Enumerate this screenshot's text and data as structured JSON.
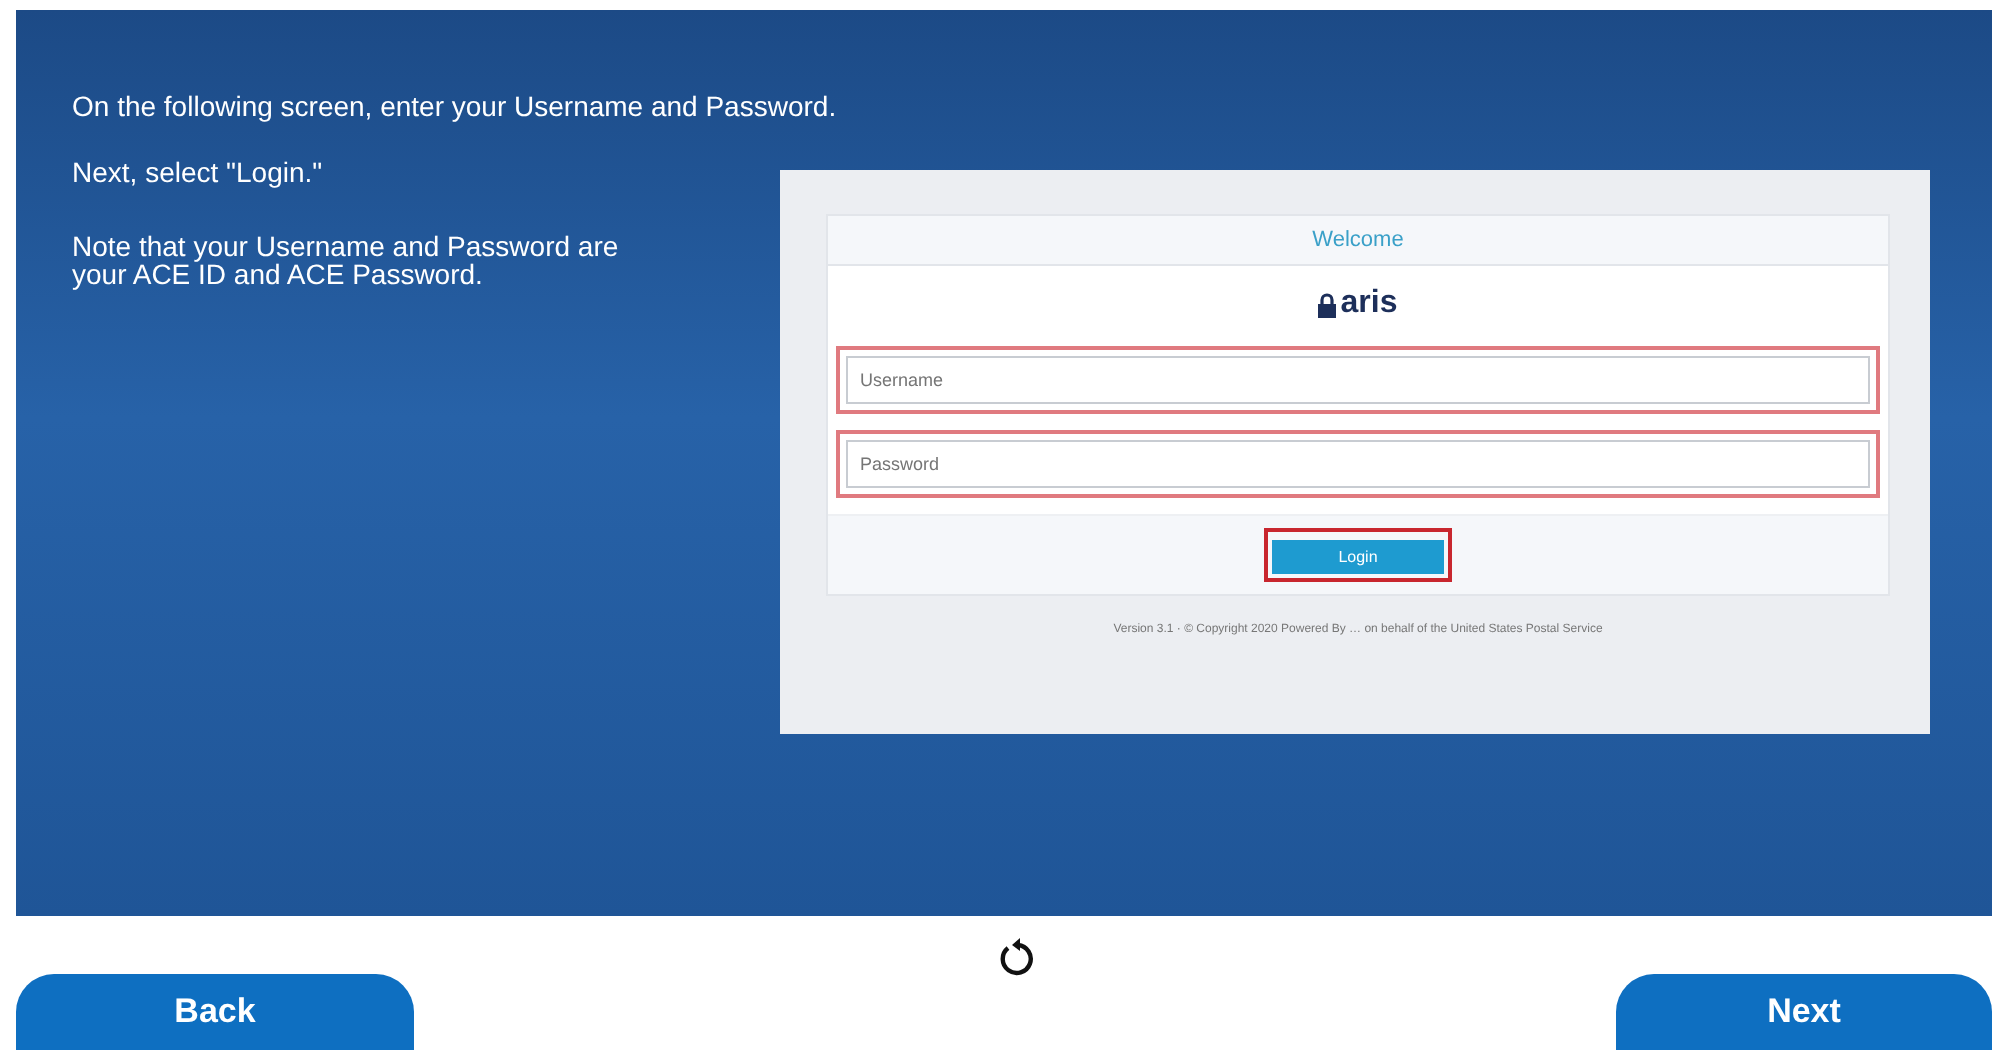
{
  "instructions": [
    {
      "text": "On the following screen, enter your Username and Password."
    },
    {
      "text": "Next, select \"Login.\""
    },
    {
      "text": "Note that your Username and Password are your ACE ID and ACE Password."
    }
  ],
  "login_screenshot": {
    "header": "Welcome",
    "logo_text": "aris",
    "fields": [
      {
        "placeholder": "Username",
        "highlighted": true
      },
      {
        "placeholder": "Password",
        "highlighted": true
      }
    ],
    "login_button": {
      "label": "Login",
      "highlighted": true
    },
    "footer": "Version 3.1 · © Copyright 2020 Powered By … on behalf of the United States Postal Service"
  },
  "nav": {
    "back": "Back",
    "next": "Next"
  }
}
